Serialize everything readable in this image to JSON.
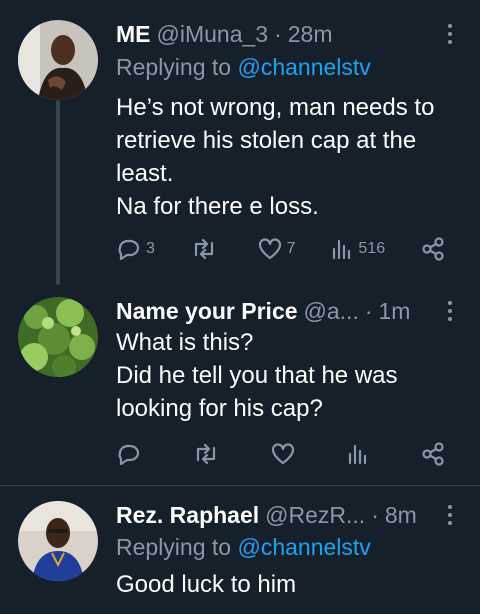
{
  "tweets": [
    {
      "name": "ME",
      "handle": "@iMuna_3",
      "sep": "·",
      "time": "28m",
      "replying_prefix": "Replying to",
      "replying_to": "@channelstv",
      "lines": [
        "He’s not wrong, man needs to",
        "retrieve his stolen cap at the",
        "least.",
        "Na for there e loss."
      ],
      "replies": "3",
      "retweets": "",
      "likes": "7",
      "views": "516"
    },
    {
      "name": "Name your Price",
      "handle": "@a...",
      "sep": "·",
      "time": "1m",
      "lines": [
        "What is this?",
        "Did he tell you that he was",
        "looking for his cap?"
      ],
      "replies": "",
      "retweets": "",
      "likes": "",
      "views": ""
    },
    {
      "name": "Rez. Raphael",
      "handle": "@RezR...",
      "sep": "·",
      "time": "8m",
      "replying_prefix": "Replying to",
      "replying_to": "@channelstv",
      "lines": [
        "Good luck to him"
      ]
    }
  ],
  "icons": {
    "reply": "reply-icon",
    "retweet": "retweet-icon",
    "like": "heart-icon",
    "views": "views-icon",
    "share": "share-icon",
    "more": "more-icon"
  },
  "colors": {
    "background": "#15202b",
    "text": "#ffffff",
    "muted": "#8899a6",
    "link": "#1da1f2",
    "divider": "#38444d"
  }
}
